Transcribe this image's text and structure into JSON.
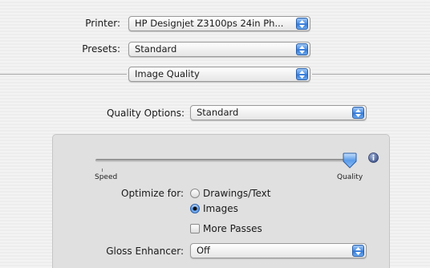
{
  "printer": {
    "label": "Printer:",
    "value": "HP Designjet Z3100ps 24in Ph..."
  },
  "presets": {
    "label": "Presets:",
    "value": "Standard"
  },
  "pane": {
    "value": "Image Quality"
  },
  "quality_options": {
    "label": "Quality Options:",
    "value": "Standard"
  },
  "slider": {
    "left_label": "Speed",
    "right_label": "Quality",
    "level": 1.0
  },
  "optimize": {
    "label": "Optimize for:",
    "options": [
      {
        "label": "Drawings/Text",
        "selected": false
      },
      {
        "label": "Images",
        "selected": true
      }
    ]
  },
  "more_passes": {
    "label": "More Passes",
    "checked": false
  },
  "gloss_enhancer": {
    "label": "Gloss Enhancer:",
    "value": "Off"
  },
  "colors": {
    "accent": "#3a7fdc",
    "panel": "#e0e0e0"
  }
}
